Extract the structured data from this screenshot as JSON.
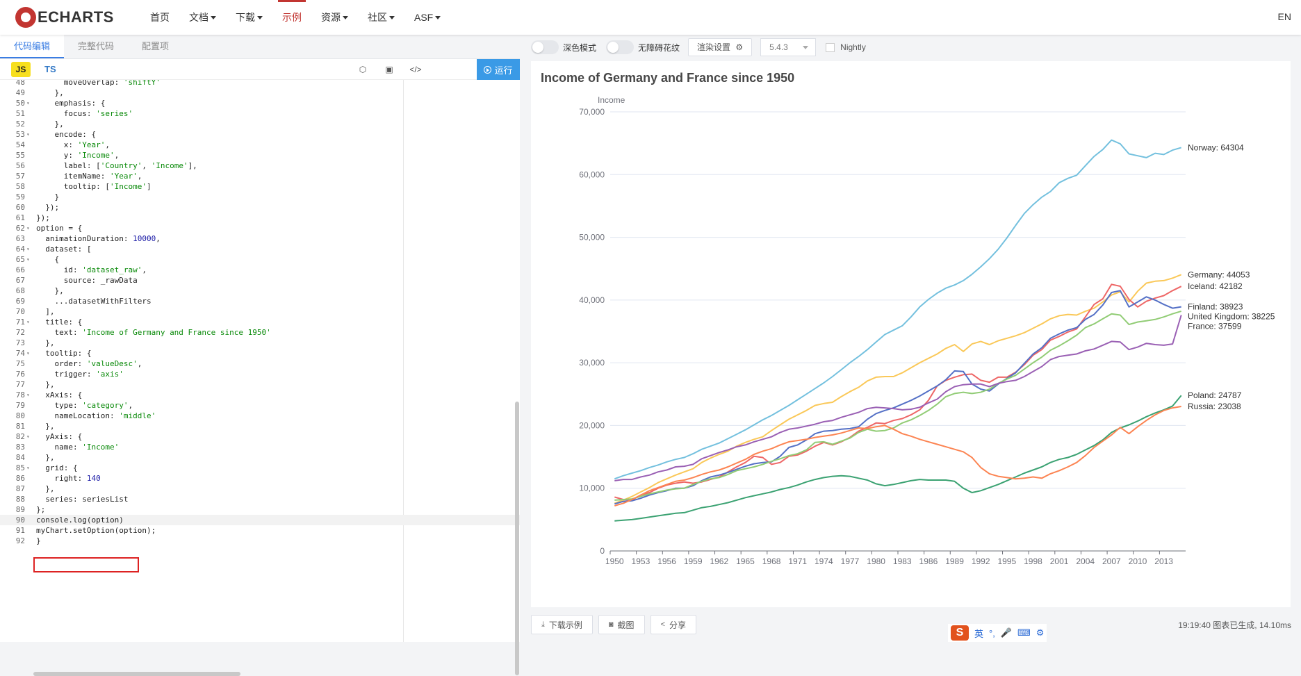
{
  "nav": {
    "logo_text": "ECHARTS",
    "items": [
      {
        "label": "首页",
        "dropdown": false
      },
      {
        "label": "文档",
        "dropdown": true
      },
      {
        "label": "下载",
        "dropdown": true
      },
      {
        "label": "示例",
        "dropdown": false,
        "active": true
      },
      {
        "label": "资源",
        "dropdown": true
      },
      {
        "label": "社区",
        "dropdown": true
      },
      {
        "label": "ASF",
        "dropdown": true
      }
    ],
    "lang": "EN"
  },
  "editor": {
    "tabs": [
      "代码编辑",
      "完整代码",
      "配置项"
    ],
    "lang_js": "JS",
    "lang_ts": "TS",
    "run_label": "运行",
    "lines": [
      {
        "n": "48",
        "fold": false,
        "code": "      moveOverlap: 'shiftY'"
      },
      {
        "n": "49",
        "fold": false,
        "code": "    },"
      },
      {
        "n": "50",
        "fold": true,
        "code": "    emphasis: {"
      },
      {
        "n": "51",
        "fold": false,
        "code": "      focus: 'series'"
      },
      {
        "n": "52",
        "fold": false,
        "code": "    },"
      },
      {
        "n": "53",
        "fold": true,
        "code": "    encode: {"
      },
      {
        "n": "54",
        "fold": false,
        "code": "      x: 'Year',"
      },
      {
        "n": "55",
        "fold": false,
        "code": "      y: 'Income',"
      },
      {
        "n": "56",
        "fold": false,
        "code": "      label: ['Country', 'Income'],"
      },
      {
        "n": "57",
        "fold": false,
        "code": "      itemName: 'Year',"
      },
      {
        "n": "58",
        "fold": false,
        "code": "      tooltip: ['Income']"
      },
      {
        "n": "59",
        "fold": false,
        "code": "    }"
      },
      {
        "n": "60",
        "fold": false,
        "code": "  });"
      },
      {
        "n": "61",
        "fold": false,
        "code": "});"
      },
      {
        "n": "62",
        "fold": true,
        "code": "option = {"
      },
      {
        "n": "63",
        "fold": false,
        "code": "  animationDuration: 10000,"
      },
      {
        "n": "64",
        "fold": true,
        "code": "  dataset: ["
      },
      {
        "n": "65",
        "fold": true,
        "code": "    {"
      },
      {
        "n": "66",
        "fold": false,
        "code": "      id: 'dataset_raw',"
      },
      {
        "n": "67",
        "fold": false,
        "code": "      source: _rawData"
      },
      {
        "n": "68",
        "fold": false,
        "code": "    },"
      },
      {
        "n": "69",
        "fold": false,
        "code": "    ...datasetWithFilters"
      },
      {
        "n": "70",
        "fold": false,
        "code": "  ],"
      },
      {
        "n": "71",
        "fold": true,
        "code": "  title: {"
      },
      {
        "n": "72",
        "fold": false,
        "code": "    text: 'Income of Germany and France since 1950'"
      },
      {
        "n": "73",
        "fold": false,
        "code": "  },"
      },
      {
        "n": "74",
        "fold": true,
        "code": "  tooltip: {"
      },
      {
        "n": "75",
        "fold": false,
        "code": "    order: 'valueDesc',"
      },
      {
        "n": "76",
        "fold": false,
        "code": "    trigger: 'axis'"
      },
      {
        "n": "77",
        "fold": false,
        "code": "  },"
      },
      {
        "n": "78",
        "fold": true,
        "code": "  xAxis: {"
      },
      {
        "n": "79",
        "fold": false,
        "code": "    type: 'category',"
      },
      {
        "n": "80",
        "fold": false,
        "code": "    nameLocation: 'middle'"
      },
      {
        "n": "81",
        "fold": false,
        "code": "  },"
      },
      {
        "n": "82",
        "fold": true,
        "code": "  yAxis: {"
      },
      {
        "n": "83",
        "fold": false,
        "code": "    name: 'Income'"
      },
      {
        "n": "84",
        "fold": false,
        "code": "  },"
      },
      {
        "n": "85",
        "fold": true,
        "code": "  grid: {"
      },
      {
        "n": "86",
        "fold": false,
        "code": "    right: 140"
      },
      {
        "n": "87",
        "fold": false,
        "code": "  },"
      },
      {
        "n": "88",
        "fold": false,
        "code": "  series: seriesList"
      },
      {
        "n": "89",
        "fold": false,
        "code": "};"
      },
      {
        "n": "90",
        "fold": false,
        "code": "console.log(option)",
        "highlight": true
      },
      {
        "n": "91",
        "fold": false,
        "code": "myChart.setOption(option);"
      },
      {
        "n": "92",
        "fold": false,
        "code": "}"
      }
    ]
  },
  "toolbar": {
    "dark_mode_label": "深色模式",
    "aria_label": "无障碍花纹",
    "render_label": "渲染设置",
    "version": "5.4.3",
    "nightly_label": "Nightly"
  },
  "bottom": {
    "download_label": "下载示例",
    "screenshot_label": "截图",
    "share_label": "分享",
    "status": "19:19:40   图表已生成, 14.10ms"
  },
  "ime": {
    "items": [
      "英",
      "°,",
      "🎤",
      "⌨",
      "⚙"
    ]
  },
  "chart_data": {
    "type": "line",
    "title": "Income of Germany and France since 1950",
    "ylabel": "Income",
    "xlabel": "",
    "x": [
      "1950",
      "1951",
      "1952",
      "1953",
      "1954",
      "1955",
      "1956",
      "1957",
      "1958",
      "1959",
      "1960",
      "1961",
      "1962",
      "1963",
      "1964",
      "1965",
      "1966",
      "1967",
      "1968",
      "1969",
      "1970",
      "1971",
      "1972",
      "1973",
      "1974",
      "1975",
      "1976",
      "1977",
      "1978",
      "1979",
      "1980",
      "1981",
      "1982",
      "1983",
      "1984",
      "1985",
      "1986",
      "1987",
      "1988",
      "1989",
      "1990",
      "1991",
      "1992",
      "1993",
      "1994",
      "1995",
      "1996",
      "1997",
      "1998",
      "1999",
      "2000",
      "2001",
      "2002",
      "2003",
      "2004",
      "2005",
      "2006",
      "2007",
      "2008",
      "2009",
      "2010",
      "2011",
      "2012",
      "2013",
      "2014",
      "2015"
    ],
    "x_tick_labels": [
      "1950",
      "1953",
      "1956",
      "1959",
      "1962",
      "1965",
      "1968",
      "1971",
      "1974",
      "1977",
      "1980",
      "1983",
      "1986",
      "1989",
      "1992",
      "1995",
      "1998",
      "2001",
      "2004",
      "2007",
      "2010",
      "2013"
    ],
    "ylim": [
      0,
      70000
    ],
    "y_ticks": [
      "0",
      "10,000",
      "20,000",
      "30,000",
      "40,000",
      "50,000",
      "60,000",
      "70,000"
    ],
    "grid": true,
    "series": [
      {
        "name": "Norway",
        "end_label": "Norway: 64304",
        "color": "#73c0de",
        "values": [
          11500,
          12000,
          12400,
          12800,
          13300,
          13700,
          14200,
          14600,
          14900,
          15500,
          16200,
          16700,
          17200,
          17900,
          18600,
          19300,
          20100,
          20900,
          21600,
          22400,
          23200,
          24100,
          25000,
          25900,
          26800,
          27800,
          28900,
          30000,
          31000,
          32100,
          33300,
          34500,
          35200,
          35900,
          37300,
          38900,
          40100,
          41100,
          41900,
          42400,
          43100,
          44100,
          45300,
          46600,
          48100,
          49900,
          51900,
          53800,
          55200,
          56400,
          57300,
          58700,
          59400,
          59900,
          61400,
          62900,
          64000,
          65500,
          64900,
          63300,
          63000,
          62700,
          63400,
          63200,
          63900,
          64304
        ]
      },
      {
        "name": "Germany",
        "end_label": "Germany: 44053",
        "color": "#fac858",
        "values": [
          7600,
          8100,
          8700,
          9400,
          10100,
          10900,
          11500,
          12100,
          12600,
          13100,
          14100,
          14800,
          15400,
          15900,
          16700,
          17300,
          17800,
          18200,
          19200,
          20100,
          21000,
          21700,
          22400,
          23200,
          23500,
          23700,
          24600,
          25400,
          26100,
          27100,
          27700,
          27800,
          27800,
          28400,
          29200,
          30000,
          30700,
          31400,
          32300,
          32900,
          31800,
          33000,
          33400,
          32900,
          33500,
          33900,
          34300,
          34800,
          35500,
          36200,
          37000,
          37500,
          37700,
          37600,
          38200,
          38700,
          39700,
          40800,
          41300,
          39700,
          41400,
          42700,
          43000,
          43100,
          43500,
          44053
        ]
      },
      {
        "name": "Iceland",
        "end_label": "Iceland: 42182",
        "color": "#ee6666",
        "values": [
          8600,
          8200,
          8100,
          8900,
          9300,
          10000,
          10500,
          10800,
          11000,
          10800,
          11000,
          11400,
          11800,
          12600,
          13400,
          14100,
          15100,
          14900,
          13800,
          14100,
          15100,
          15300,
          15900,
          16700,
          17300,
          16900,
          17400,
          18100,
          19100,
          19700,
          20400,
          20300,
          20800,
          21100,
          21700,
          22500,
          24000,
          26300,
          27200,
          27700,
          28100,
          28200,
          27200,
          26900,
          27700,
          27700,
          28500,
          29700,
          31200,
          32100,
          33600,
          34200,
          34900,
          35400,
          37300,
          39300,
          40200,
          42500,
          42200,
          40100,
          38900,
          39800,
          40300,
          40700,
          41500,
          42182
        ]
      },
      {
        "name": "Finland",
        "end_label": "Finland: 38923",
        "color": "#5470c6",
        "values": [
          7500,
          7900,
          8000,
          8400,
          8900,
          9300,
          9600,
          10000,
          10000,
          10400,
          11200,
          11800,
          12100,
          12500,
          13000,
          13500,
          13900,
          14100,
          14200,
          15100,
          16500,
          16900,
          17700,
          18700,
          19100,
          19200,
          19400,
          19500,
          19800,
          21000,
          21900,
          22400,
          22800,
          23400,
          24000,
          24700,
          25500,
          26300,
          27300,
          28700,
          28600,
          26600,
          25800,
          25500,
          26600,
          27500,
          28400,
          29900,
          31400,
          32400,
          33900,
          34600,
          35200,
          35600,
          36900,
          37700,
          39200,
          41200,
          41500,
          38900,
          39700,
          40500,
          40000,
          39300,
          38700,
          38923
        ]
      },
      {
        "name": "United Kingdom",
        "end_label": "United Kingdom: 38225",
        "color": "#91cc75",
        "values": [
          8100,
          8200,
          8300,
          8700,
          9100,
          9400,
          9700,
          9900,
          10000,
          10600,
          11100,
          11500,
          11700,
          12200,
          12800,
          13100,
          13400,
          13800,
          14300,
          14700,
          15200,
          15500,
          16100,
          17300,
          17400,
          17000,
          17500,
          18000,
          18900,
          19400,
          19100,
          19200,
          19600,
          20400,
          20900,
          21600,
          22400,
          23400,
          24600,
          25100,
          25300,
          25100,
          25300,
          25800,
          26700,
          27400,
          28000,
          29000,
          30000,
          30900,
          32000,
          32700,
          33500,
          34400,
          35600,
          36200,
          37000,
          37800,
          37600,
          36100,
          36500,
          36700,
          36900,
          37300,
          37800,
          38225
        ]
      },
      {
        "name": "France",
        "end_label": "France: 37599",
        "color": "#9a60b4",
        "values": [
          11200,
          11400,
          11400,
          11800,
          12100,
          12600,
          12900,
          13400,
          13500,
          13800,
          14700,
          15200,
          15700,
          16100,
          16600,
          16900,
          17400,
          17800,
          18200,
          18900,
          19400,
          19600,
          19900,
          20200,
          20600,
          20800,
          21300,
          21700,
          22100,
          22700,
          22900,
          22800,
          22700,
          22500,
          22600,
          22900,
          23600,
          24200,
          25400,
          26200,
          26500,
          26600,
          26600,
          26200,
          26700,
          27000,
          27200,
          27800,
          28600,
          29400,
          30500,
          31000,
          31200,
          31400,
          31900,
          32200,
          32800,
          33400,
          33300,
          32100,
          32500,
          33100,
          32900,
          32800,
          33000,
          37599
        ]
      },
      {
        "name": "Poland",
        "end_label": "Poland: 24787",
        "color": "#3ba272",
        "values": [
          4800,
          4900,
          5000,
          5200,
          5400,
          5600,
          5800,
          6000,
          6100,
          6500,
          6900,
          7100,
          7400,
          7700,
          8100,
          8500,
          8800,
          9100,
          9400,
          9800,
          10100,
          10500,
          11000,
          11400,
          11700,
          11900,
          12000,
          11900,
          11600,
          11300,
          10700,
          10400,
          10600,
          10900,
          11200,
          11400,
          11300,
          11300,
          11300,
          11100,
          10000,
          9300,
          9600,
          10100,
          10600,
          11200,
          11800,
          12400,
          12900,
          13400,
          14100,
          14600,
          14900,
          15400,
          16100,
          16800,
          17700,
          18900,
          19600,
          20100,
          20700,
          21400,
          22000,
          22500,
          23100,
          24787
        ]
      },
      {
        "name": "Russia",
        "end_label": "Russia: 23038",
        "color": "#fc8452",
        "values": [
          7200,
          7600,
          8200,
          8900,
          9600,
          10100,
          10600,
          11100,
          11300,
          11700,
          12200,
          12600,
          12900,
          13400,
          14000,
          14600,
          15400,
          15900,
          16300,
          16900,
          17400,
          17600,
          17800,
          18100,
          18300,
          18500,
          18800,
          19200,
          19600,
          19500,
          19800,
          20000,
          19400,
          18700,
          18300,
          17800,
          17400,
          17000,
          16600,
          16200,
          15800,
          14900,
          13300,
          12300,
          11900,
          11700,
          11500,
          11600,
          11800,
          11600,
          12300,
          12800,
          13400,
          14100,
          15200,
          16500,
          17500,
          18500,
          19700,
          18700,
          19800,
          20800,
          21700,
          22400,
          22800,
          23038
        ]
      }
    ]
  }
}
